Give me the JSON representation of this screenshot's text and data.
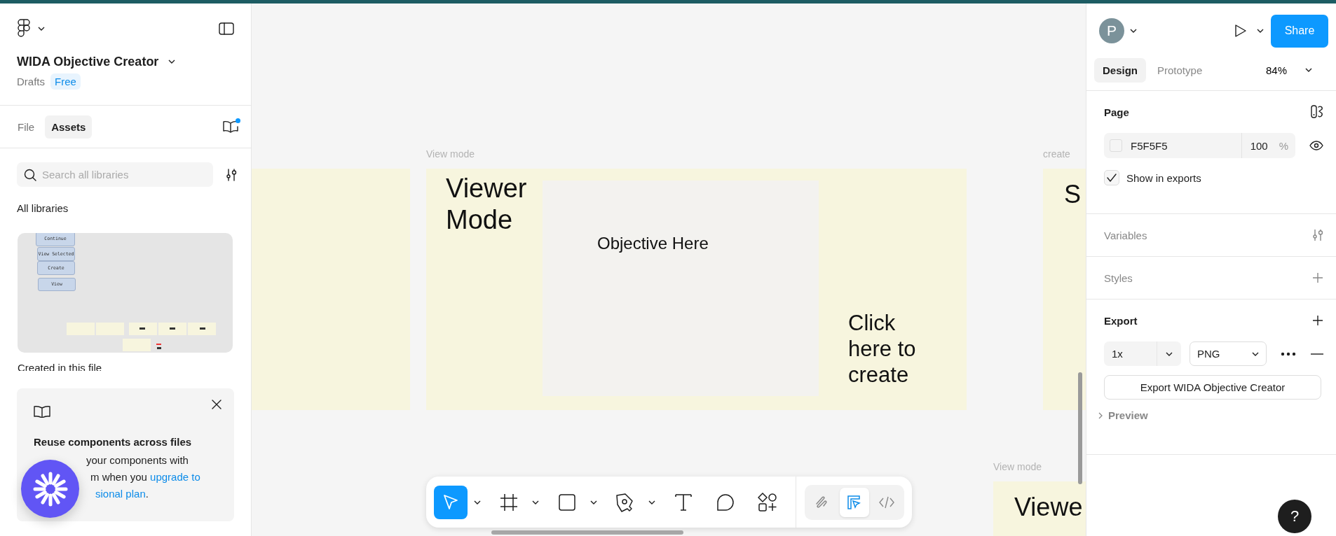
{
  "file": {
    "title": "WIDA Objective Creator",
    "location": "Drafts",
    "plan": "Free"
  },
  "left_tabs": [
    {
      "label": "File",
      "selected": false
    },
    {
      "label": "Assets",
      "selected": true
    }
  ],
  "library_updates": true,
  "search": {
    "placeholder": "Search all libraries"
  },
  "libraries_heading": "All libraries",
  "library_preview": {
    "buttons": [
      "Continue",
      "View Selected",
      "Create",
      "View"
    ]
  },
  "created_heading": "Created in this file",
  "promo": {
    "title": "Reuse components across files",
    "lines": [
      {
        "parts": [
          {
            "text": "your components with",
            "link": false
          }
        ]
      },
      {
        "parts": [
          {
            "text": "m when you ",
            "link": false
          },
          {
            "text": "upgrade to",
            "link": true
          }
        ]
      },
      {
        "parts": [
          {
            "text": "sional plan",
            "link": true
          },
          {
            "text": ".",
            "link": false
          }
        ]
      }
    ]
  },
  "canvas": {
    "labels": [
      "View mode",
      "create",
      "View mode"
    ],
    "frames": [
      {
        "kind": "blank"
      },
      {
        "kind": "viewer",
        "title": "Viewer Mode",
        "objective": "Objective Here",
        "action": "Click here to create"
      },
      {
        "kind": "partial",
        "title": "S"
      },
      {
        "kind": "partial",
        "title": "Viewe"
      }
    ]
  },
  "toolbar": {
    "tools": [
      {
        "kind": "move",
        "selected": true,
        "menu": true
      },
      {
        "kind": "frame",
        "selected": false,
        "menu": true
      },
      {
        "kind": "rectangle",
        "selected": false,
        "menu": true
      },
      {
        "kind": "pen",
        "selected": false,
        "menu": true
      },
      {
        "kind": "text",
        "selected": false,
        "menu": false
      },
      {
        "kind": "comment",
        "selected": false,
        "menu": false
      },
      {
        "kind": "actions",
        "selected": false,
        "menu": false
      }
    ],
    "modes": [
      {
        "kind": "draw",
        "selected": false
      },
      {
        "kind": "design",
        "selected": true
      },
      {
        "kind": "dev",
        "selected": false
      }
    ]
  },
  "right_panel": {
    "avatar": "P",
    "share": "Share",
    "tabs": [
      {
        "label": "Design",
        "selected": true
      },
      {
        "label": "Prototype",
        "selected": false
      }
    ],
    "zoom": "84%",
    "page": {
      "heading": "Page",
      "fill_hex": "F5F5F5",
      "opacity": "100",
      "unit": "%",
      "show_in_exports": true,
      "show_label": "Show in exports"
    },
    "sections": [
      {
        "kind": "variables",
        "label": "Variables"
      },
      {
        "kind": "styles",
        "label": "Styles"
      }
    ],
    "export": {
      "heading": "Export",
      "scale": "1x",
      "format": "PNG",
      "button": "Export WIDA Objective Creator",
      "preview": "Preview",
      "preview_expanded": false
    }
  },
  "help": "?"
}
